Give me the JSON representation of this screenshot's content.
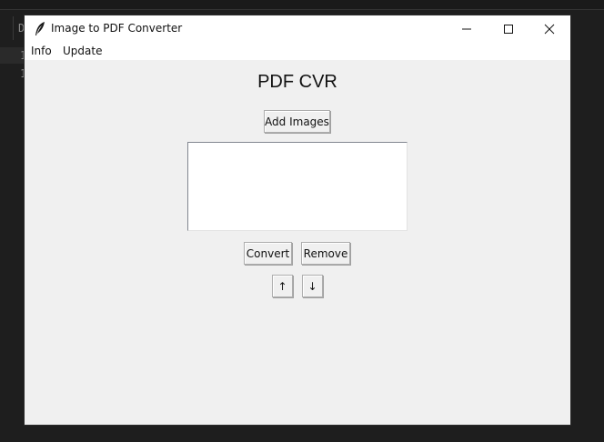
{
  "window": {
    "title": "Image to PDF Converter",
    "controls": {
      "minimize": "minimize-icon",
      "maximize": "maximize-icon",
      "close": "close-icon"
    }
  },
  "menu": {
    "items": [
      {
        "label": "Info"
      },
      {
        "label": "Update"
      }
    ]
  },
  "main": {
    "heading": "PDF CVR",
    "add_images_label": "Add Images",
    "convert_label": "Convert",
    "remove_label": "Remove",
    "move_up_label": "↑",
    "move_down_label": "↓",
    "image_list": []
  },
  "background": {
    "editor_chars": [
      "D",
      "1",
      "1"
    ]
  },
  "colors": {
    "window_bg": "#f0f0f0",
    "titlebar_bg": "#ffffff",
    "desktop_bg": "#1e1e1e"
  }
}
